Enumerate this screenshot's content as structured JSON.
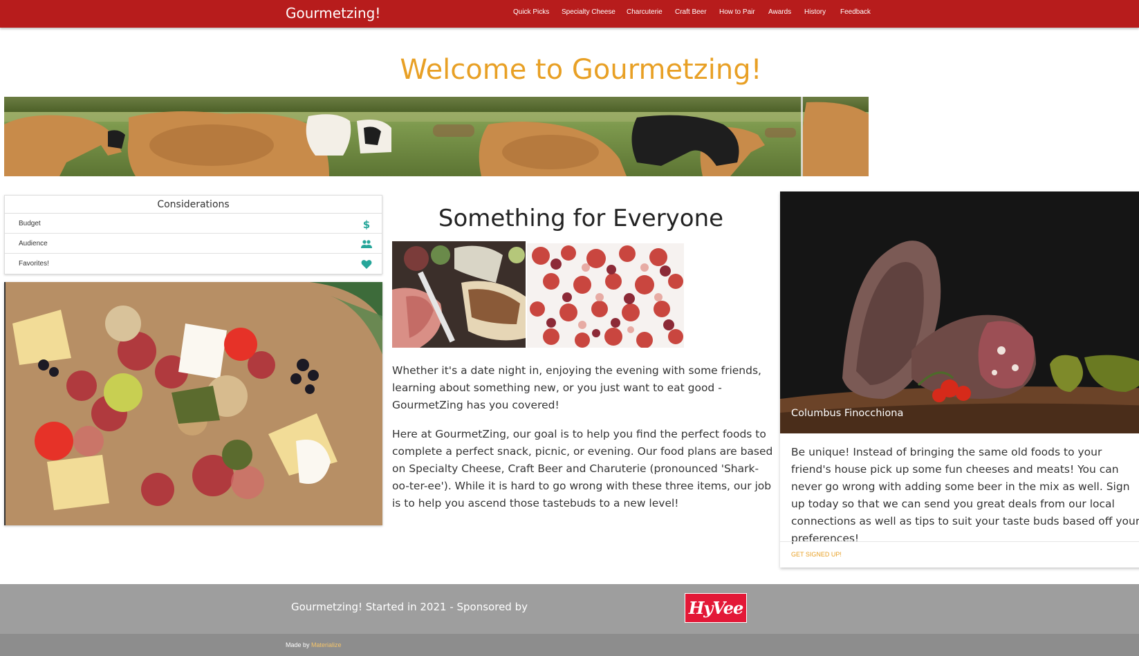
{
  "nav": {
    "brand": "Gourmetzing!",
    "links": [
      "Quick Picks",
      "Specialty Cheese",
      "Charcuterie",
      "Craft Beer",
      "How to Pair",
      "Awards",
      "History",
      "Feedback"
    ]
  },
  "hero": {
    "title": "Welcome to Gourmetzing!"
  },
  "considerations": {
    "title": "Considerations",
    "items": [
      {
        "label": "Budget",
        "icon": "dollar-icon"
      },
      {
        "label": "Audience",
        "icon": "people-icon"
      },
      {
        "label": "Favorites!",
        "icon": "heart-icon"
      }
    ]
  },
  "main": {
    "title": "Something for Everyone",
    "paragraph1": "Whether it's a date night in, enjoying the evening with some friends, learning about something new, or you just want to eat good - GourmetZing has you covered!",
    "paragraph2": "Here at GourmetZing, our goal is to help you find the perfect foods to complete a perfect snack, picnic, or evening. Our food plans are based on Specialty Cheese, Craft Beer and Charuterie (pronounced 'Shark-oo-ter-ee'). While it is hard to go wrong with these three items, our job is to help you ascend those tastebuds to a new level!"
  },
  "card": {
    "caption": "Columbus Finocchiona",
    "text": "Be unique! Instead of bringing the same old foods to your friend's house pick up some fun cheeses and meats! You can never go wrong with adding some beer in the mix as well. Sign up today so that we can send you great deals from our local connections as well as tips to suit your taste buds based off your preferences!",
    "action": "Get Signed Up!"
  },
  "footer": {
    "text": "Gourmetzing! Started in 2021 - Sponsored by",
    "sponsor_logo": "HyVee",
    "made_by": "Made by",
    "made_by_link": "Materialize"
  },
  "colors": {
    "nav": "#b71c1c",
    "accent": "#e8a025",
    "teal": "#26a69a",
    "footer": "#9e9e9e"
  }
}
